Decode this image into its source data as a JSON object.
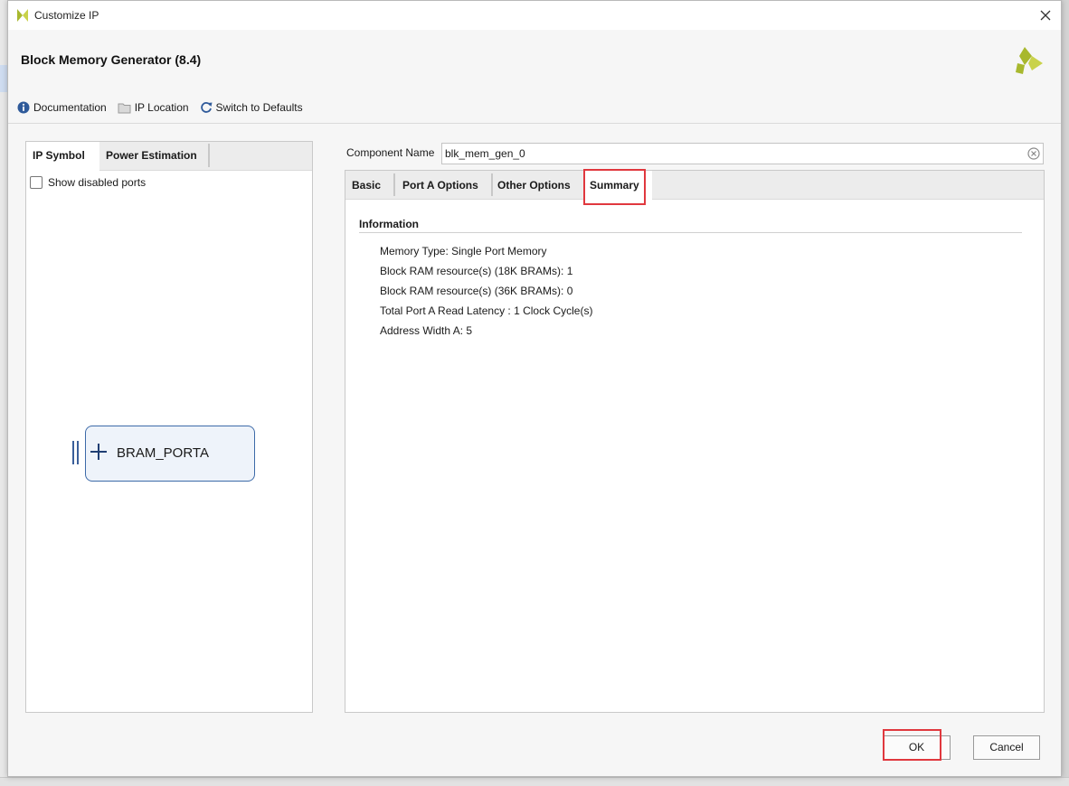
{
  "window": {
    "title": "Customize IP"
  },
  "header": {
    "block_title": "Block Memory Generator (8.4)",
    "toolbar": {
      "documentation": "Documentation",
      "ip_location": "IP Location",
      "switch_defaults": "Switch to Defaults"
    }
  },
  "left_panel": {
    "tabs": [
      {
        "label": "IP Symbol",
        "active": true
      },
      {
        "label": "Power Estimation",
        "active": false
      }
    ],
    "show_disabled_ports": {
      "label": "Show disabled ports",
      "checked": false
    },
    "symbol": {
      "port_label": "BRAM_PORTA"
    }
  },
  "component": {
    "label": "Component Name",
    "value": "blk_mem_gen_0"
  },
  "right_panel": {
    "tabs": [
      {
        "label": "Basic",
        "active": false
      },
      {
        "label": "Port A Options",
        "active": false
      },
      {
        "label": "Other Options",
        "active": false
      },
      {
        "label": "Summary",
        "active": true
      }
    ],
    "summary": {
      "section_title": "Information",
      "lines": [
        "Memory Type: Single Port Memory",
        "Block RAM resource(s) (18K BRAMs): 1",
        "Block RAM resource(s) (36K BRAMs): 0",
        "Total Port A Read Latency : 1 Clock Cycle(s)",
        "Address Width A: 5"
      ]
    }
  },
  "footer": {
    "ok_label": "OK",
    "cancel_label": "Cancel"
  },
  "colors": {
    "highlight": "#e0383e",
    "logo_green": "#a8b82e",
    "symbol_border": "#3d6aa8",
    "info_icon": "#2f5a9a"
  },
  "icons": {
    "title_logo": "xilinx-logo-icon",
    "brand_logo": "xilinx-logo-icon",
    "close": "close-icon",
    "documentation": "info-icon",
    "ip_location": "folder-icon",
    "switch_defaults": "refresh-icon",
    "clear": "clear-icon"
  }
}
